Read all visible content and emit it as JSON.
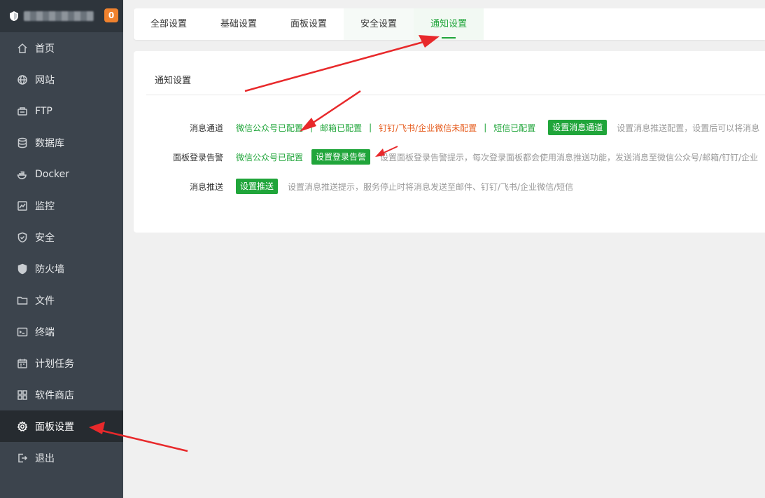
{
  "sidebar": {
    "badge": "0",
    "items": [
      {
        "label": "首页",
        "icon": "home-icon"
      },
      {
        "label": "网站",
        "icon": "globe-icon"
      },
      {
        "label": "FTP",
        "icon": "ftp-icon"
      },
      {
        "label": "数据库",
        "icon": "database-icon"
      },
      {
        "label": "Docker",
        "icon": "docker-icon"
      },
      {
        "label": "监控",
        "icon": "monitor-icon"
      },
      {
        "label": "安全",
        "icon": "shield-icon"
      },
      {
        "label": "防火墙",
        "icon": "firewall-icon"
      },
      {
        "label": "文件",
        "icon": "folder-icon"
      },
      {
        "label": "终端",
        "icon": "terminal-icon"
      },
      {
        "label": "计划任务",
        "icon": "calendar-icon"
      },
      {
        "label": "软件商店",
        "icon": "apps-icon"
      },
      {
        "label": "面板设置",
        "icon": "gear-icon"
      },
      {
        "label": "退出",
        "icon": "logout-icon"
      }
    ]
  },
  "tabs": [
    "全部设置",
    "基础设置",
    "面板设置",
    "安全设置",
    "通知设置"
  ],
  "panel": {
    "title": "通知设置",
    "rows": {
      "channel": {
        "label": "消息通道",
        "wechat": "微信公众号已配置",
        "mail": "邮箱已配置",
        "dingtalk": "钉钉/飞书/企业微信未配置",
        "sms": "短信已配置",
        "sep": "|",
        "button": "设置消息通道",
        "hint": "设置消息推送配置，设置后可以将消息"
      },
      "login_alert": {
        "label": "面板登录告警",
        "wechat": "微信公众号已配置",
        "button": "设置登录告警",
        "hint": "设置面板登录告警提示，每次登录面板都会使用消息推送功能，发送消息至微信公众号/邮箱/钉钉/企业"
      },
      "push": {
        "label": "消息推送",
        "button": "设置推送",
        "hint": "设置消息推送提示，服务停止时将消息发送至邮件、钉钉/飞书/企业微信/短信"
      }
    }
  },
  "colors": {
    "accent": "#20a53a",
    "warning": "#e65c1e",
    "sidebar": "#3c444d",
    "annotation": "#e8292b"
  }
}
